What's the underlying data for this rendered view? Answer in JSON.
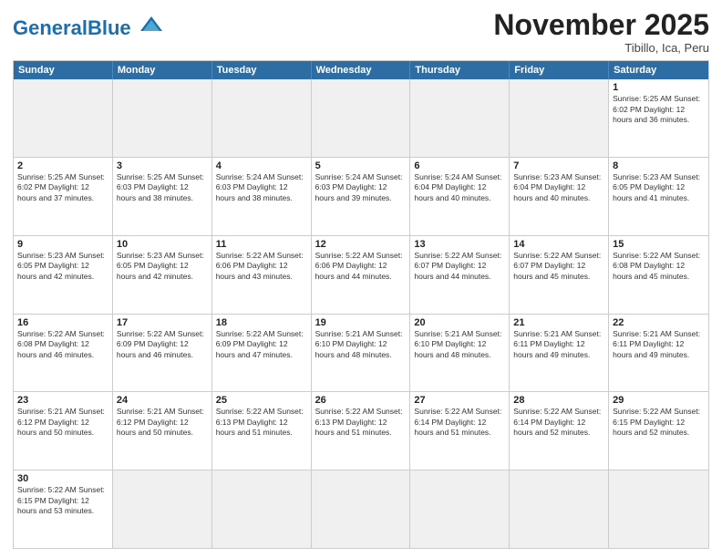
{
  "logo": {
    "text_general": "General",
    "text_blue": "Blue"
  },
  "header": {
    "month": "November 2025",
    "location": "Tibillo, Ica, Peru"
  },
  "days_of_week": [
    "Sunday",
    "Monday",
    "Tuesday",
    "Wednesday",
    "Thursday",
    "Friday",
    "Saturday"
  ],
  "weeks": [
    [
      {
        "day": "",
        "empty": true
      },
      {
        "day": "",
        "empty": true
      },
      {
        "day": "",
        "empty": true
      },
      {
        "day": "",
        "empty": true
      },
      {
        "day": "",
        "empty": true
      },
      {
        "day": "",
        "empty": true
      },
      {
        "day": "1",
        "info": "Sunrise: 5:25 AM\nSunset: 6:02 PM\nDaylight: 12 hours and 36 minutes."
      }
    ],
    [
      {
        "day": "2",
        "info": "Sunrise: 5:25 AM\nSunset: 6:02 PM\nDaylight: 12 hours and 37 minutes."
      },
      {
        "day": "3",
        "info": "Sunrise: 5:25 AM\nSunset: 6:03 PM\nDaylight: 12 hours and 38 minutes."
      },
      {
        "day": "4",
        "info": "Sunrise: 5:24 AM\nSunset: 6:03 PM\nDaylight: 12 hours and 38 minutes."
      },
      {
        "day": "5",
        "info": "Sunrise: 5:24 AM\nSunset: 6:03 PM\nDaylight: 12 hours and 39 minutes."
      },
      {
        "day": "6",
        "info": "Sunrise: 5:24 AM\nSunset: 6:04 PM\nDaylight: 12 hours and 40 minutes."
      },
      {
        "day": "7",
        "info": "Sunrise: 5:23 AM\nSunset: 6:04 PM\nDaylight: 12 hours and 40 minutes."
      },
      {
        "day": "8",
        "info": "Sunrise: 5:23 AM\nSunset: 6:05 PM\nDaylight: 12 hours and 41 minutes."
      }
    ],
    [
      {
        "day": "9",
        "info": "Sunrise: 5:23 AM\nSunset: 6:05 PM\nDaylight: 12 hours and 42 minutes."
      },
      {
        "day": "10",
        "info": "Sunrise: 5:23 AM\nSunset: 6:05 PM\nDaylight: 12 hours and 42 minutes."
      },
      {
        "day": "11",
        "info": "Sunrise: 5:22 AM\nSunset: 6:06 PM\nDaylight: 12 hours and 43 minutes."
      },
      {
        "day": "12",
        "info": "Sunrise: 5:22 AM\nSunset: 6:06 PM\nDaylight: 12 hours and 44 minutes."
      },
      {
        "day": "13",
        "info": "Sunrise: 5:22 AM\nSunset: 6:07 PM\nDaylight: 12 hours and 44 minutes."
      },
      {
        "day": "14",
        "info": "Sunrise: 5:22 AM\nSunset: 6:07 PM\nDaylight: 12 hours and 45 minutes."
      },
      {
        "day": "15",
        "info": "Sunrise: 5:22 AM\nSunset: 6:08 PM\nDaylight: 12 hours and 45 minutes."
      }
    ],
    [
      {
        "day": "16",
        "info": "Sunrise: 5:22 AM\nSunset: 6:08 PM\nDaylight: 12 hours and 46 minutes."
      },
      {
        "day": "17",
        "info": "Sunrise: 5:22 AM\nSunset: 6:09 PM\nDaylight: 12 hours and 46 minutes."
      },
      {
        "day": "18",
        "info": "Sunrise: 5:22 AM\nSunset: 6:09 PM\nDaylight: 12 hours and 47 minutes."
      },
      {
        "day": "19",
        "info": "Sunrise: 5:21 AM\nSunset: 6:10 PM\nDaylight: 12 hours and 48 minutes."
      },
      {
        "day": "20",
        "info": "Sunrise: 5:21 AM\nSunset: 6:10 PM\nDaylight: 12 hours and 48 minutes."
      },
      {
        "day": "21",
        "info": "Sunrise: 5:21 AM\nSunset: 6:11 PM\nDaylight: 12 hours and 49 minutes."
      },
      {
        "day": "22",
        "info": "Sunrise: 5:21 AM\nSunset: 6:11 PM\nDaylight: 12 hours and 49 minutes."
      }
    ],
    [
      {
        "day": "23",
        "info": "Sunrise: 5:21 AM\nSunset: 6:12 PM\nDaylight: 12 hours and 50 minutes."
      },
      {
        "day": "24",
        "info": "Sunrise: 5:21 AM\nSunset: 6:12 PM\nDaylight: 12 hours and 50 minutes."
      },
      {
        "day": "25",
        "info": "Sunrise: 5:22 AM\nSunset: 6:13 PM\nDaylight: 12 hours and 51 minutes."
      },
      {
        "day": "26",
        "info": "Sunrise: 5:22 AM\nSunset: 6:13 PM\nDaylight: 12 hours and 51 minutes."
      },
      {
        "day": "27",
        "info": "Sunrise: 5:22 AM\nSunset: 6:14 PM\nDaylight: 12 hours and 51 minutes."
      },
      {
        "day": "28",
        "info": "Sunrise: 5:22 AM\nSunset: 6:14 PM\nDaylight: 12 hours and 52 minutes."
      },
      {
        "day": "29",
        "info": "Sunrise: 5:22 AM\nSunset: 6:15 PM\nDaylight: 12 hours and 52 minutes."
      }
    ],
    [
      {
        "day": "30",
        "info": "Sunrise: 5:22 AM\nSunset: 6:15 PM\nDaylight: 12 hours and 53 minutes."
      },
      {
        "day": "",
        "empty": true
      },
      {
        "day": "",
        "empty": true
      },
      {
        "day": "",
        "empty": true
      },
      {
        "day": "",
        "empty": true
      },
      {
        "day": "",
        "empty": true
      },
      {
        "day": "",
        "empty": true
      }
    ]
  ]
}
